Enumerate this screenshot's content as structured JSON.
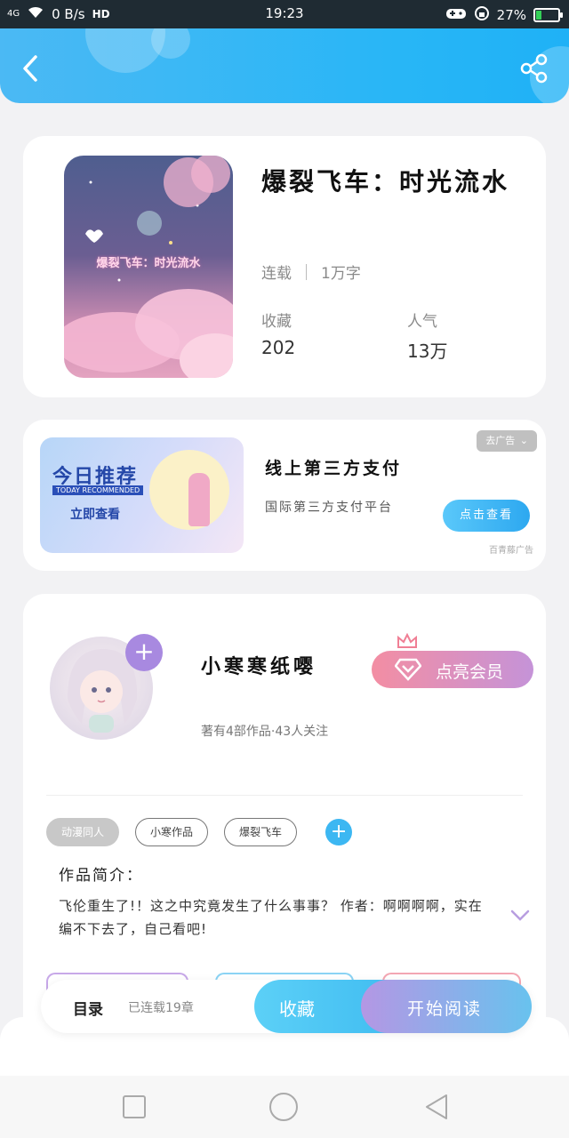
{
  "status_bar": {
    "network": "4G",
    "speed": "0 B/s",
    "hd": "HD",
    "time": "19:23",
    "battery": "27%",
    "battery_level": 0.27
  },
  "book": {
    "cover_title": "爆裂飞车：时光流水",
    "title": "爆裂飞车：时光流水",
    "status": "连载",
    "word_count": "1万字",
    "favorites_label": "收藏",
    "favorites_value": "202",
    "popularity_label": "人气",
    "popularity_value": "13万"
  },
  "ad": {
    "image_line1": "今日推荐",
    "image_line2": "TODAY RECOMMENDED",
    "image_line3": "立即查看",
    "title": "线上第三方支付",
    "subtitle": "国际第三方支付平台",
    "close_label": "去广告",
    "button_label": "点击查看",
    "source": "百青藤广告"
  },
  "author": {
    "name": "小寒寒纸嘤",
    "meta": "著有4部作品·43人关注",
    "vip_label": "点亮会员",
    "follow_icon": "+"
  },
  "tags": [
    "动漫同人",
    "小寒作品",
    "爆裂飞车"
  ],
  "tag_add_icon": "+",
  "intro": {
    "label": "作品简介：",
    "text": "飞伦重生了!！这之中究竟发生了什么事事？ 作者：啊啊啊啊，实在编不下去了，自己看吧!"
  },
  "action_bar": {
    "toc_label": "目录",
    "toc_status": "已连载19章",
    "favorite_label": "收藏",
    "read_label": "开始阅读"
  },
  "colors": {
    "header_blue": "#28b6f6",
    "accent_purple": "#a889e0",
    "vip_pink": "#f38ea3"
  }
}
